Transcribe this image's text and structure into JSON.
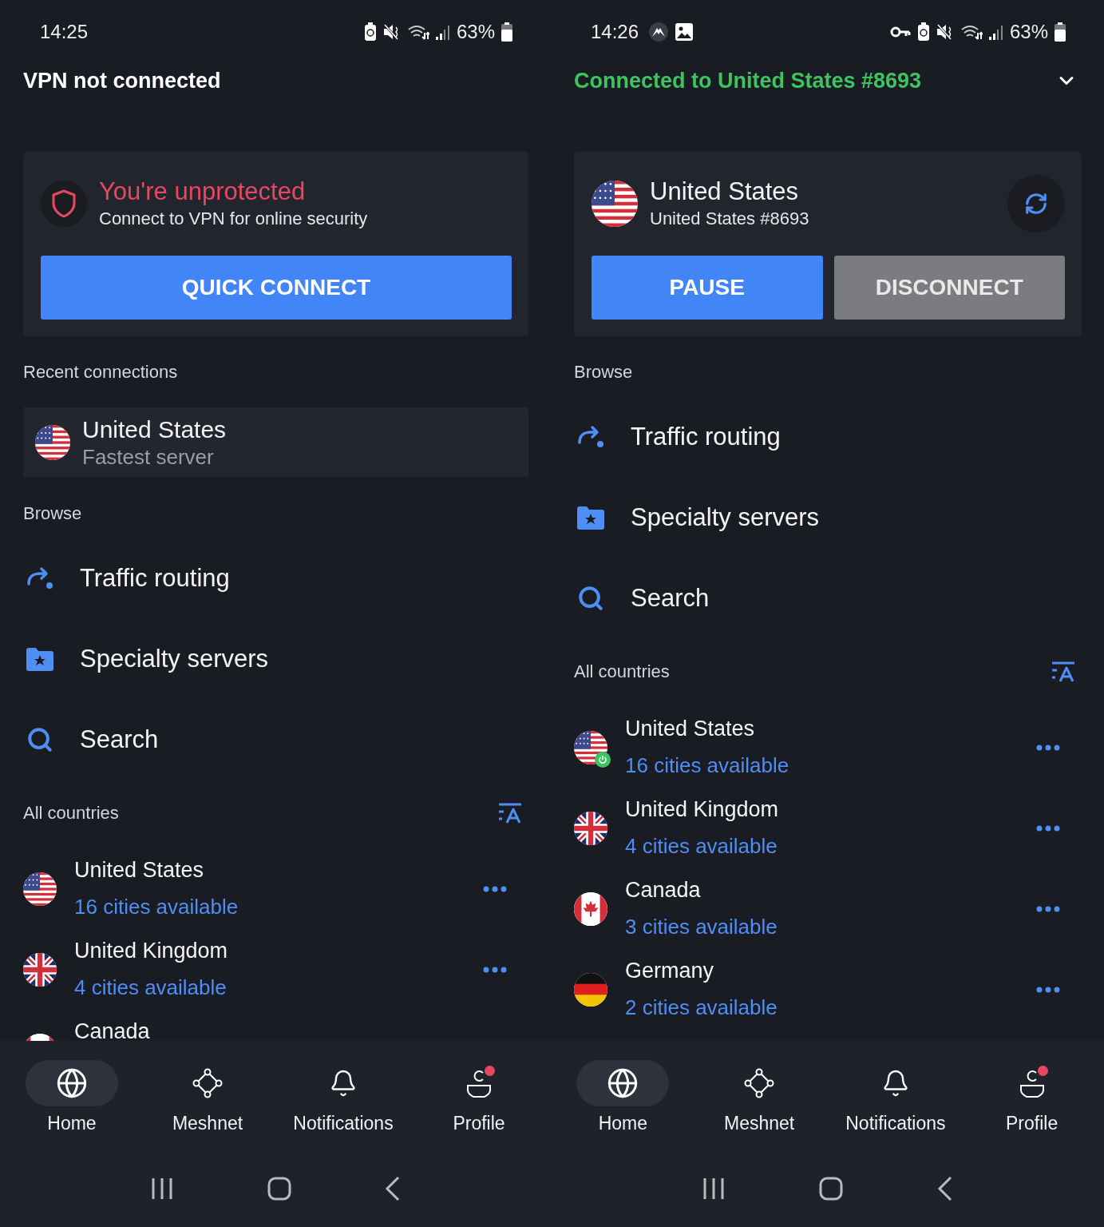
{
  "panels": [
    {
      "status_bar": {
        "time": "14:25",
        "battery": "63%",
        "vpn_key": false
      },
      "header": {
        "title": "VPN not connected",
        "connected": false
      },
      "card": {
        "kind": "unprotected",
        "title": "You're unprotected",
        "subtitle": "Connect to VPN for online security",
        "buttons": [
          {
            "label": "QUICK CONNECT",
            "kind": "primary"
          }
        ]
      },
      "recent": {
        "heading": "Recent connections",
        "items": [
          {
            "flag": {
              "kind": "us"
            },
            "name": "United States",
            "subtitle": "Fastest server"
          }
        ]
      },
      "browse": {
        "heading": "Browse",
        "items": [
          {
            "label": "Traffic routing"
          },
          {
            "label": "Specialty servers"
          },
          {
            "label": "Search"
          }
        ]
      },
      "countries": {
        "heading": "All countries",
        "items": [
          {
            "flag": {
              "kind": "us"
            },
            "name": "United States",
            "cities": "16 cities available",
            "connected": false
          },
          {
            "flag": {
              "kind": "gb"
            },
            "name": "United Kingdom",
            "cities": "4 cities available",
            "connected": false
          },
          {
            "flag": {
              "kind": "ca"
            },
            "name": "Canada",
            "connected": false
          }
        ]
      },
      "nav": [
        {
          "label": "Home",
          "selected": true,
          "alert": false
        },
        {
          "label": "Meshnet",
          "selected": false,
          "alert": false
        },
        {
          "label": "Notifications",
          "selected": false,
          "alert": false
        },
        {
          "label": "Profile",
          "selected": false,
          "alert": true
        }
      ]
    },
    {
      "status_bar": {
        "time": "14:26",
        "battery": "63%",
        "vpn_key": true,
        "notification_icons": [
          {
            "kind": "app"
          },
          {
            "kind": "image"
          }
        ]
      },
      "header": {
        "title": "Connected to United States #8693",
        "connected": true
      },
      "card": {
        "kind": "connected",
        "flag": {
          "kind": "us"
        },
        "title": "United States",
        "subtitle": "United States #8693",
        "buttons": [
          {
            "label": "PAUSE",
            "kind": "primary"
          },
          {
            "label": "DISCONNECT",
            "kind": "secondary"
          }
        ]
      },
      "browse": {
        "heading": "Browse",
        "items": [
          {
            "label": "Traffic routing"
          },
          {
            "label": "Specialty servers"
          },
          {
            "label": "Search"
          }
        ]
      },
      "countries": {
        "heading": "All countries",
        "items": [
          {
            "flag": {
              "kind": "us"
            },
            "name": "United States",
            "cities": "16 cities available",
            "connected": true
          },
          {
            "flag": {
              "kind": "gb"
            },
            "name": "United Kingdom",
            "cities": "4 cities available",
            "connected": false
          },
          {
            "flag": {
              "kind": "ca"
            },
            "name": "Canada",
            "cities": "3 cities available",
            "connected": false
          },
          {
            "flag": {
              "kind": "de"
            },
            "name": "Germany",
            "cities": "2 cities available",
            "connected": false
          }
        ]
      },
      "nav": [
        {
          "label": "Home",
          "selected": true,
          "alert": false
        },
        {
          "label": "Meshnet",
          "selected": false,
          "alert": false
        },
        {
          "label": "Notifications",
          "selected": false,
          "alert": false
        },
        {
          "label": "Profile",
          "selected": false,
          "alert": true
        }
      ]
    }
  ]
}
